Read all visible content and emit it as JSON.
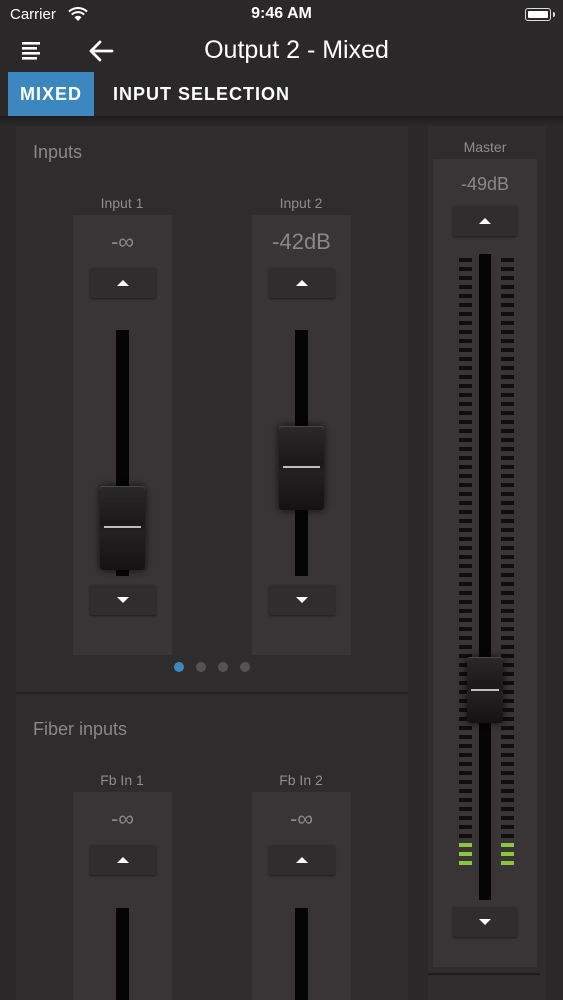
{
  "status": {
    "carrier": "Carrier",
    "time": "9:46 AM"
  },
  "header": {
    "title": "Output 2 - Mixed",
    "menu_icon": "menu-icon",
    "back_icon": "back-arrow-icon"
  },
  "tabs": [
    {
      "label": "MIXED",
      "active": true
    },
    {
      "label": "INPUT SELECTION",
      "active": false
    }
  ],
  "inputs": {
    "title": "Inputs",
    "channels": [
      {
        "label": "Input 1",
        "value": "-∞",
        "fader_level": 0.2
      },
      {
        "label": "Input 2",
        "value": "-42dB",
        "fader_level": 0.55
      }
    ],
    "page_count": 4,
    "active_page": 1
  },
  "fiber_inputs": {
    "title": "Fiber inputs",
    "channels": [
      {
        "label": "Fb In 1",
        "value": "-∞"
      },
      {
        "label": "Fb In 2",
        "value": "-∞"
      }
    ]
  },
  "master": {
    "label": "Master",
    "value": "-49dB",
    "fader_level": 0.35,
    "meter_lit_segments": 3
  },
  "colors": {
    "accent": "#3d87c0",
    "meter_green": "#8cc63f",
    "background": "#2b282a"
  }
}
